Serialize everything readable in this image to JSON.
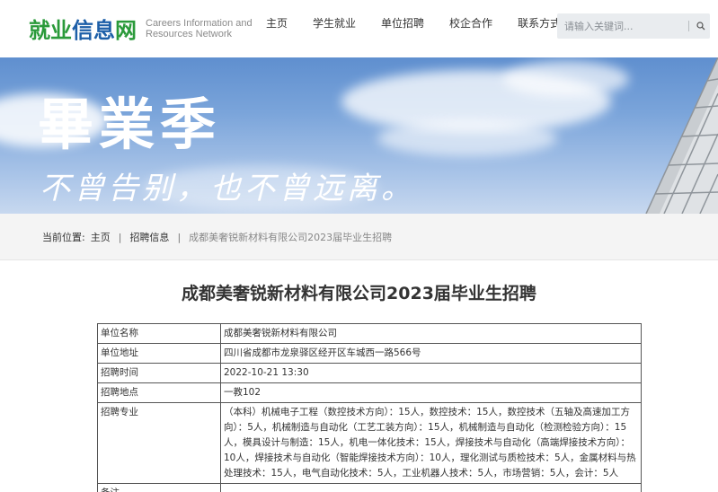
{
  "header": {
    "logo_text_green": "就业",
    "logo_text_blue": "信息",
    "logo_text_green2": "网",
    "logo_en_line1": "Careers Information and",
    "logo_en_line2": "Resources Network",
    "nav": [
      "主页",
      "学生就业",
      "单位招聘",
      "校企合作",
      "联系方式"
    ],
    "search_placeholder": "请输入关键词...",
    "search_icon": "search-icon"
  },
  "banner": {
    "title": "畢業季",
    "subtitle": "不曾告别，也不曾远离。"
  },
  "breadcrumb": {
    "label": "当前位置:",
    "home": "主页",
    "section": "招聘信息",
    "current": "成都美奢锐新材料有限公司2023届毕业生招聘"
  },
  "article": {
    "title": "成都美奢锐新材料有限公司2023届毕业生招聘",
    "rows": [
      {
        "key": "单位名称",
        "value": "成都美奢锐新材料有限公司"
      },
      {
        "key": "单位地址",
        "value": "四川省成都市龙泉驿区经开区车城西一路566号"
      },
      {
        "key": "招聘时间",
        "value": "2022-10-21 13:30"
      },
      {
        "key": "招聘地点",
        "value": "一教102"
      },
      {
        "key": "招聘专业",
        "value": "（本科）机械电子工程（数控技术方向）：15人，数控技术：15人，数控技术（五轴及高速加工方向）：5人，机械制造与自动化（工艺工装方向）：15人，机械制造与自动化（检测检验方向）：15人，模具设计与制造：15人，机电一体化技术：15人，焊接技术与自动化（高端焊接技术方向）：10人，焊接技术与自动化（智能焊接技术方向）：10人，理化测试与质检技术：5人，金属材料与热处理技术：15人，电气自动化技术：5人，工业机器人技术：5人，市场营销：5人，会计：5人"
      },
      {
        "key": "备注",
        "value": ""
      }
    ]
  }
}
